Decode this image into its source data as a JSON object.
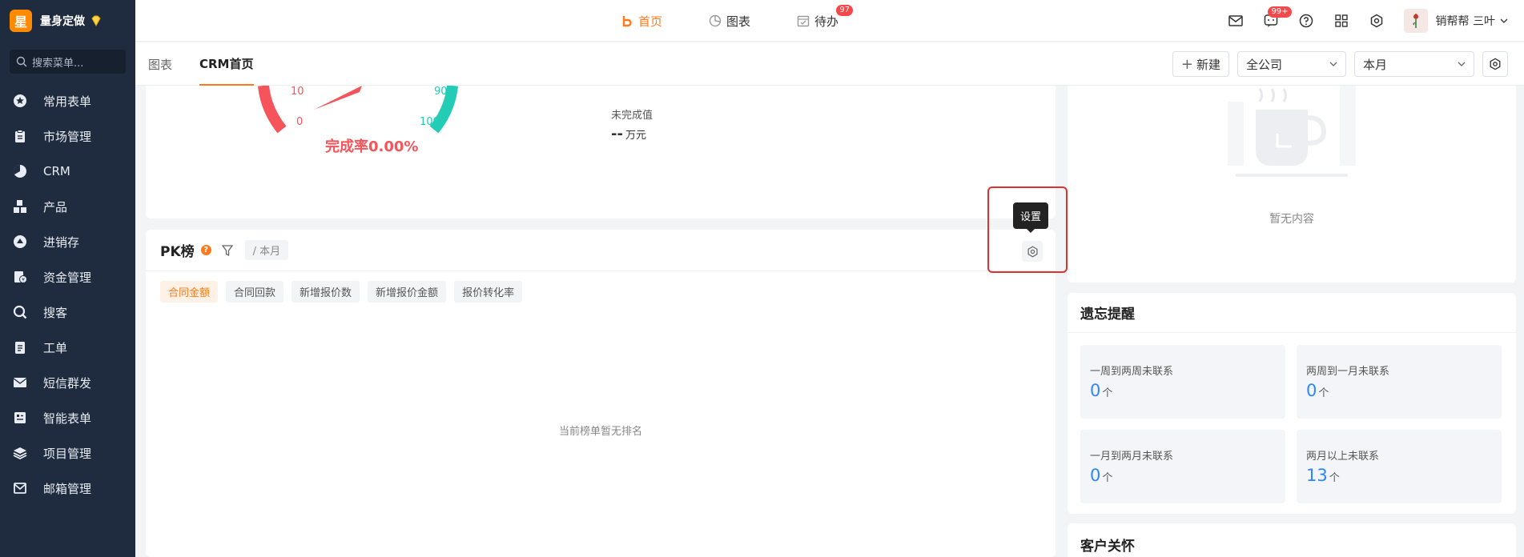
{
  "brand": {
    "logo_char": "星",
    "name": "量身定做"
  },
  "sidebar": {
    "search_placeholder": "搜索菜单...",
    "items": [
      {
        "label": "常用表单",
        "icon": "star-icon"
      },
      {
        "label": "市场管理",
        "icon": "clipboard-icon"
      },
      {
        "label": "CRM",
        "icon": "pie-icon"
      },
      {
        "label": "产品",
        "icon": "boxes-icon"
      },
      {
        "label": "进销存",
        "icon": "warehouse-icon"
      },
      {
        "label": "资金管理",
        "icon": "money-icon"
      },
      {
        "label": "搜客",
        "icon": "search-icon"
      },
      {
        "label": "工单",
        "icon": "ticket-icon"
      },
      {
        "label": "短信群发",
        "icon": "mail-icon"
      },
      {
        "label": "智能表单",
        "icon": "form-icon"
      },
      {
        "label": "项目管理",
        "icon": "layers-icon"
      },
      {
        "label": "邮箱管理",
        "icon": "envelope-icon"
      }
    ]
  },
  "topnav": {
    "home": "首页",
    "charts": "图表",
    "todo": "待办",
    "todo_badge": "97"
  },
  "topright": {
    "msg_badge": "99+",
    "user_name": "销帮帮 三叶"
  },
  "subtabs": {
    "tab_charts": "图表",
    "tab_crm": "CRM首页",
    "new_button": "新建",
    "scope_select": "全公司",
    "period_select": "本月"
  },
  "gauge": {
    "tick_10": "10",
    "tick_0": "0",
    "tick_90": "90",
    "tick_100": "100",
    "completion_rate": "完成率0.00%",
    "unfinished_label": "未完成值",
    "unfinished_value": "--",
    "unfinished_unit": "万元"
  },
  "pk": {
    "title": "PK榜",
    "help": "?",
    "period": "/ 本月",
    "tabs": [
      "合同金额",
      "合同回款",
      "新增报价数",
      "新增报价金额",
      "报价转化率"
    ],
    "empty_text": "当前榜单暂无排名",
    "tooltip": "设置"
  },
  "right_top": {
    "empty_text": "暂无内容"
  },
  "memo": {
    "title": "遗忘提醒",
    "boxes": [
      {
        "label": "一周到两周未联系",
        "value": "0",
        "unit": "个"
      },
      {
        "label": "两周到一月未联系",
        "value": "0",
        "unit": "个"
      },
      {
        "label": "一月到两月未联系",
        "value": "0",
        "unit": "个"
      },
      {
        "label": "两月以上未联系",
        "value": "13",
        "unit": "个"
      }
    ]
  },
  "care": {
    "title": "客户关怀"
  },
  "colors": {
    "accent": "#ff7a1a",
    "sidebar_bg": "#1f2b3e",
    "gauge_red": "#f5545a",
    "gauge_teal": "#22ccb5",
    "link_blue": "#2b86ff"
  }
}
